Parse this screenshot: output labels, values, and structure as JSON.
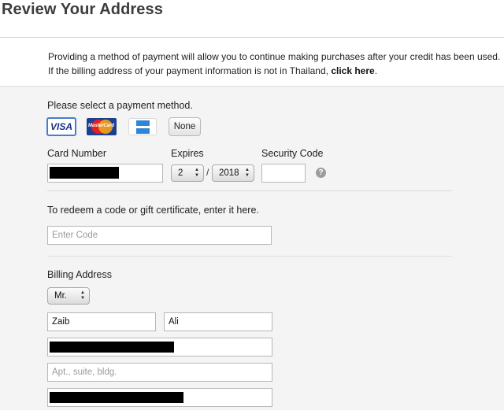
{
  "page": {
    "title": "Review Your Address"
  },
  "notice": {
    "line1": "Providing a method of payment will allow you to continue making purchases after your credit has been used.",
    "line2_prefix": "If the billing address of your payment information is not in Thailand,",
    "line2_link": "click here",
    "line2_suffix": "."
  },
  "payment": {
    "prompt": "Please select a payment method.",
    "methods": [
      {
        "id": "visa",
        "label": "VISA",
        "selected": true
      },
      {
        "id": "mastercard",
        "label": "MasterCard",
        "selected": false
      },
      {
        "id": "amex",
        "label": "",
        "selected": false
      },
      {
        "id": "none",
        "label": "None",
        "selected": false
      }
    ],
    "card_number_label": "Card Number",
    "card_number_value": "",
    "expires_label": "Expires",
    "expires_month": "2",
    "expires_separator": "/",
    "expires_year": "2018",
    "security_code_label": "Security Code",
    "security_code_value": "",
    "help_icon_glyph": "?"
  },
  "redeem": {
    "label": "To redeem a code or gift certificate, enter it here.",
    "placeholder": "Enter Code"
  },
  "billing": {
    "label": "Billing Address",
    "salutation": "Mr.",
    "first_name": "Zaib",
    "last_name": "Ali",
    "street": "",
    "apt_placeholder": "Apt., suite, bldg.",
    "city": ""
  },
  "colors": {
    "selected_border": "#4a7bd0",
    "panel_bg": "#f4f4f4"
  }
}
